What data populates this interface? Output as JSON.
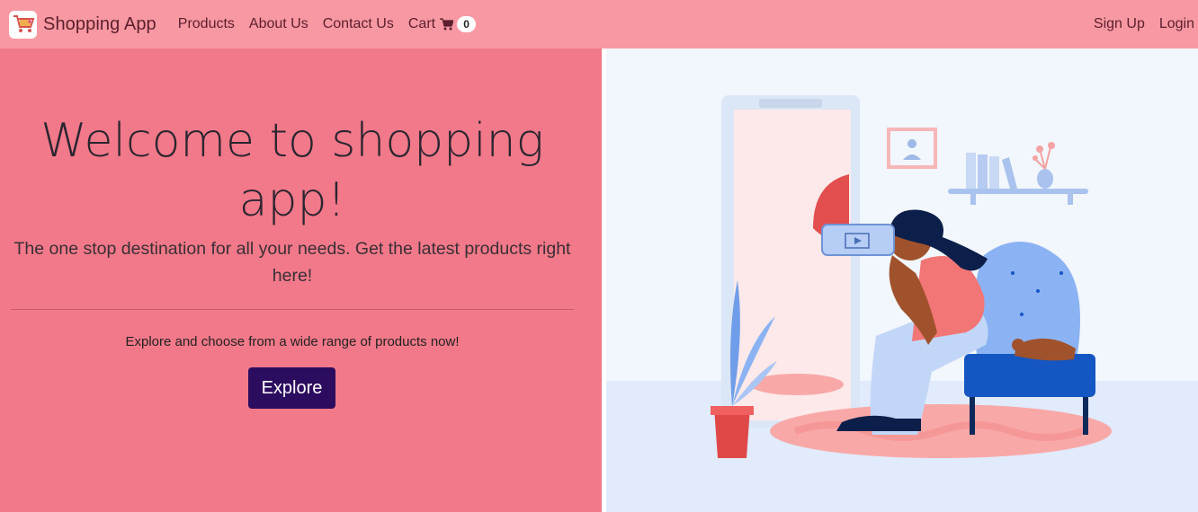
{
  "navbar": {
    "brand_name": "Shopping App",
    "links": [
      {
        "label": "Products"
      },
      {
        "label": "About Us"
      },
      {
        "label": "Contact Us"
      }
    ],
    "cart_label": "Cart",
    "cart_count": "0",
    "signup_label": "Sign Up",
    "login_label": "Login",
    "brand_icon": "shopping-cart-logo-icon",
    "cart_icon": "cart-icon"
  },
  "hero": {
    "title": "Welcome to shopping app!",
    "subtitle": "The one stop destination for all your needs. Get the latest products right here!",
    "lead": "Explore and choose from a wide range of products now!",
    "button_label": "Explore"
  },
  "colors": {
    "navbar": "#f898a2",
    "hero_background": "#f27989",
    "button": "#2c0c5e",
    "illustration_background": "#f2f6fd"
  }
}
